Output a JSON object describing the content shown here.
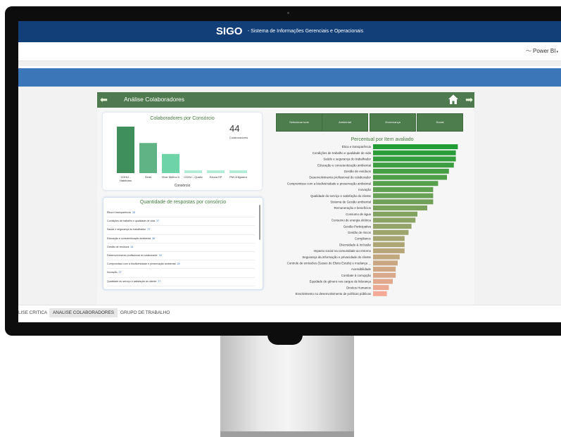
{
  "app": {
    "brand": "SIGO",
    "subtitle": "- Sistema de Informações Gerenciais e Operacionais",
    "powerbi_label": "Power BI"
  },
  "report": {
    "title": "Análise Colaboradores",
    "kpi_value": "44",
    "kpi_label": "Colaboradores",
    "bar_chart_title": "Colaboradores por Consórcio",
    "bar_chart_xlabel": "Consórcio",
    "list_title": "Quantidade de respostas por consórcio",
    "list_items": [
      {
        "label": "Ética e transparência",
        "value": "38"
      },
      {
        "label": "Condições de trabalho e qualidade de vida",
        "value": "37"
      },
      {
        "label": "Saúde e segurança do trabalhador",
        "value": "37"
      },
      {
        "label": "Educação e conscientização ambiental",
        "value": "36"
      },
      {
        "label": "Gestão de resíduos",
        "value": "34"
      },
      {
        "label": "Desenvolvimento profissional do colaborador",
        "value": "33"
      },
      {
        "label": "Compromisso com a biodiversidade e preservação ambiental",
        "value": "28"
      },
      {
        "label": "Inovação",
        "value": "27"
      },
      {
        "label": "Qualidade do serviço e satisfação do cliente",
        "value": "27"
      }
    ],
    "slicers": [
      "Selecionar tudo",
      "Ambiental",
      "Governança",
      "Social"
    ],
    "percent_chart_title": "Percentual por Item avaliado"
  },
  "tabs": [
    "LISE CRITICA",
    "ANALISE COLABORADORES",
    "GRUPO DE TRABALHO"
  ],
  "colors": {
    "topbar": "#123f78",
    "accent_blue": "#3b76b9",
    "header_green": "#4f7a4f",
    "bar_dark": "#3f8f5c",
    "bar_mid": "#5fb385",
    "bar_light": "#6fd3a8",
    "bar_pale": "#b0ecd6"
  },
  "chart_data": [
    {
      "type": "bar",
      "title": "Colaboradores por Consórcio",
      "xlabel": "Consórcio",
      "ylabel": "",
      "categories": [
        "CDHU - Habitrans",
        "Sede",
        "Viver Melhor II",
        "CDHU - Qualiv",
        "Educa SP",
        "PM Oriiguaíra"
      ],
      "values": [
        17,
        11,
        7,
        1,
        1,
        1
      ],
      "ylim": [
        0,
        18
      ]
    },
    {
      "type": "bar",
      "orientation": "horizontal",
      "title": "Percentual por Item avaliado",
      "categories": [
        "Ética e transparência",
        "Condições de trabalho e qualidade de vida",
        "Saúde e segurança do trabalhador",
        "Educação e conscientização ambiental",
        "Gestão de resíduos",
        "Desenvolvimento profissional do colaborador",
        "Compromisso com a biodiversidade e preservação ambiental",
        "Inovação",
        "Qualidade do serviço e satisfação do cliente",
        "Sistema de Gestão ambiental",
        "Remuneração e benefícios",
        "Consumo de água",
        "Consumo de energia elétrica",
        "Gestão Participativa",
        "Gestão de riscos",
        "Compliance",
        "Diversidade & Inclusão",
        "Impacto social na comunidade ao entorno",
        "Segurança da informação e privacidade do cliente",
        "Controle de emissões (Gases do Efeito Estufa) e mudança ...",
        "Acessibilidade",
        "Combate à corrupção",
        "Equidade de gênero nos cargos de liderança",
        "Direitos Humanos",
        "Envolvimento no desenvolvimento de políticas públicas"
      ],
      "values": [
        86,
        84,
        84,
        82,
        77,
        75,
        66,
        61,
        61,
        61,
        55,
        45,
        43,
        39,
        36,
        32,
        32,
        32,
        27,
        25,
        23,
        23,
        20,
        16,
        14
      ],
      "xlim": [
        0,
        100
      ]
    }
  ]
}
